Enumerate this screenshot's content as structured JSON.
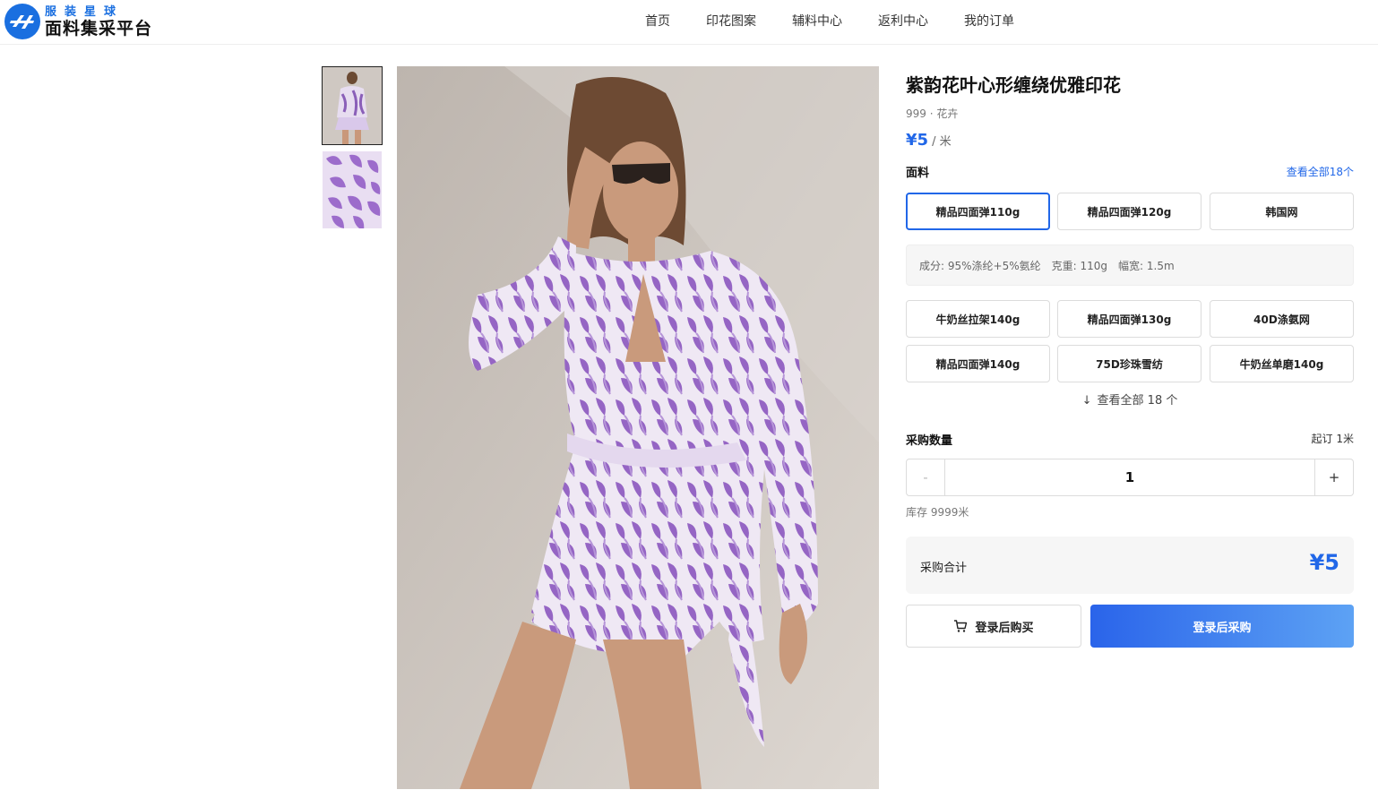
{
  "brand": {
    "tagline": "服装星球",
    "name": "面料集采平台",
    "icon": "logo-mark"
  },
  "nav": {
    "items": [
      "首页",
      "印花图案",
      "辅料中心",
      "返利中心",
      "我的订单"
    ]
  },
  "gallery": {
    "thumbnails": [
      "model-photo",
      "pattern-swatch"
    ],
    "selected_index": 0
  },
  "product": {
    "title": "紫韵花叶心形缠绕优雅印花",
    "meta": "999 · 花卉",
    "price": "¥5",
    "unit": "/ 米"
  },
  "fabric": {
    "label": "面料",
    "view_all_link": "查看全部18个",
    "options_row1": [
      "精品四面弹110g",
      "精品四面弹120g",
      "韩国网"
    ],
    "selected": "精品四面弹110g",
    "specs": [
      "成分: 95%涤纶+5%氨纶",
      "克重: 110g",
      "幅宽: 1.5m"
    ],
    "options_more": [
      "牛奶丝拉架140g",
      "精品四面弹130g",
      "40D涤氨网",
      "精品四面弹140g",
      "75D珍珠雪纺",
      "牛奶丝单磨140g"
    ],
    "expand_label": "查看全部 18 个",
    "expand_icon": "arrow-down-icon"
  },
  "quantity": {
    "label": "采购数量",
    "moq": "起订 1米",
    "minus": "-",
    "value": "1",
    "plus": "+",
    "stock": "库存 9999米"
  },
  "total": {
    "label": "采购合计",
    "value": "¥5"
  },
  "actions": {
    "cart_label": "登录后购买",
    "cart_icon": "cart-icon",
    "buy_label": "登录后采购"
  },
  "colors": {
    "accent": "#2167e8",
    "accent_light": "#5da2f4",
    "print_purple": "#8a5fb8"
  }
}
